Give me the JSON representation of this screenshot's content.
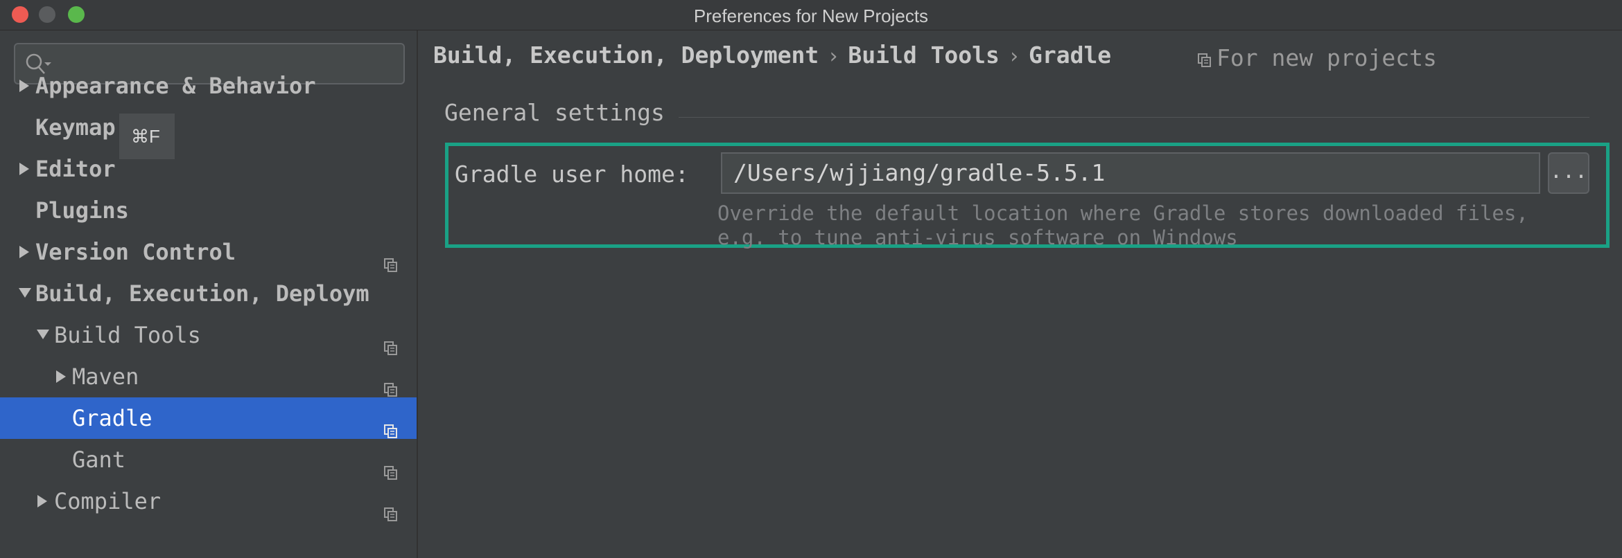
{
  "window": {
    "title": "Preferences for New Projects"
  },
  "search": {
    "placeholder": "",
    "value": "",
    "shortcut_hint": "⌘F"
  },
  "sidebar": {
    "items": [
      {
        "label": "Appearance & Behavior",
        "arrow": "right",
        "level": 0,
        "bold": true,
        "copy": false
      },
      {
        "label": "Keymap",
        "arrow": "none",
        "level": 0,
        "bold": true,
        "copy": false
      },
      {
        "label": "Editor",
        "arrow": "right",
        "level": 0,
        "bold": true,
        "copy": false
      },
      {
        "label": "Plugins",
        "arrow": "none",
        "level": 0,
        "bold": true,
        "copy": false
      },
      {
        "label": "Version Control",
        "arrow": "right",
        "level": 0,
        "bold": true,
        "copy": true
      },
      {
        "label": "Build, Execution, Deploym",
        "arrow": "down",
        "level": 0,
        "bold": true,
        "copy": false
      },
      {
        "label": "Build Tools",
        "arrow": "down",
        "level": 1,
        "bold": false,
        "copy": true
      },
      {
        "label": "Maven",
        "arrow": "right",
        "level": 2,
        "bold": false,
        "copy": true
      },
      {
        "label": "Gradle",
        "arrow": "none",
        "level": 2,
        "bold": false,
        "copy": true,
        "selected": true
      },
      {
        "label": "Gant",
        "arrow": "none",
        "level": 2,
        "bold": false,
        "copy": true
      },
      {
        "label": "Compiler",
        "arrow": "right",
        "level": 1,
        "bold": false,
        "copy": true
      }
    ]
  },
  "main": {
    "breadcrumb": [
      "Build, Execution, Deployment",
      "Build Tools",
      "Gradle"
    ],
    "breadcrumb_separator": "›",
    "scope_label": "For new projects",
    "group_title": "General settings",
    "gradle_home": {
      "label": "Gradle user home:",
      "value": "/Users/wjjiang/gradle-5.5.1",
      "browse_label": "...",
      "hint": "Override the default location where Gradle stores downloaded files, e.g. to tune anti-virus software on Windows"
    }
  },
  "colors": {
    "background": "#3c3f41",
    "selection": "#2f65ca",
    "highlight_border": "#1aa185",
    "close": "#ee5b53",
    "minimize": "#5a5c5e",
    "maximize": "#5ab84c"
  }
}
